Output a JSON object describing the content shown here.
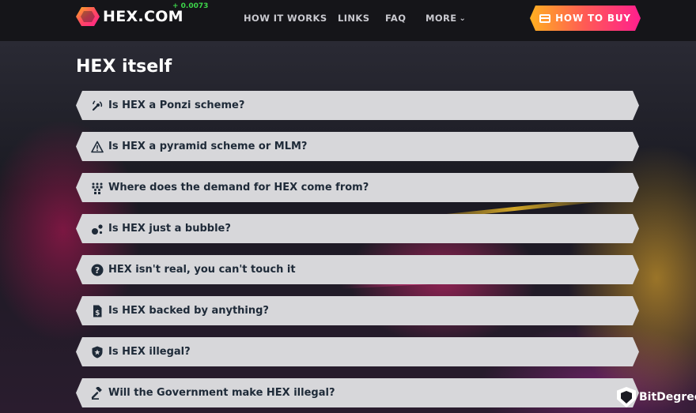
{
  "header": {
    "logo_text": "HEX.COM",
    "price": "+ 0.0073",
    "nav": [
      {
        "label": "HOW IT WORKS"
      },
      {
        "label": "LINKS"
      },
      {
        "label": "FAQ"
      },
      {
        "label": "MORE"
      }
    ],
    "buy_button": {
      "label": "HOW TO BUY",
      "icon": "credit-card-icon"
    }
  },
  "colors": {
    "accent_start": "#ffb020",
    "accent_mid": "#ff5a55",
    "accent_end": "#ff1f8e",
    "price_up": "#3dd64a",
    "faq_bg": "#d7d7da",
    "faq_text": "#1e2a38"
  },
  "section": {
    "title": "HEX itself",
    "items": [
      {
        "icon": "antenna-signal-icon",
        "label": "Is HEX a Ponzi scheme?"
      },
      {
        "icon": "warning-triangle-icon",
        "label": "Is HEX a pyramid scheme or MLM?"
      },
      {
        "icon": "people-group-icon",
        "label": "Where does the demand for HEX come from?"
      },
      {
        "icon": "bubbles-icon",
        "label": "Is HEX just a bubble?"
      },
      {
        "icon": "question-circle-icon",
        "label": "HEX isn't real, you can't touch it"
      },
      {
        "icon": "dollar-document-icon",
        "label": "Is HEX backed by anything?"
      },
      {
        "icon": "shield-star-icon",
        "label": "Is HEX illegal?"
      },
      {
        "icon": "gavel-icon",
        "label": "Will the Government make HEX illegal?"
      }
    ]
  },
  "watermark": {
    "text": "BitDegree"
  }
}
